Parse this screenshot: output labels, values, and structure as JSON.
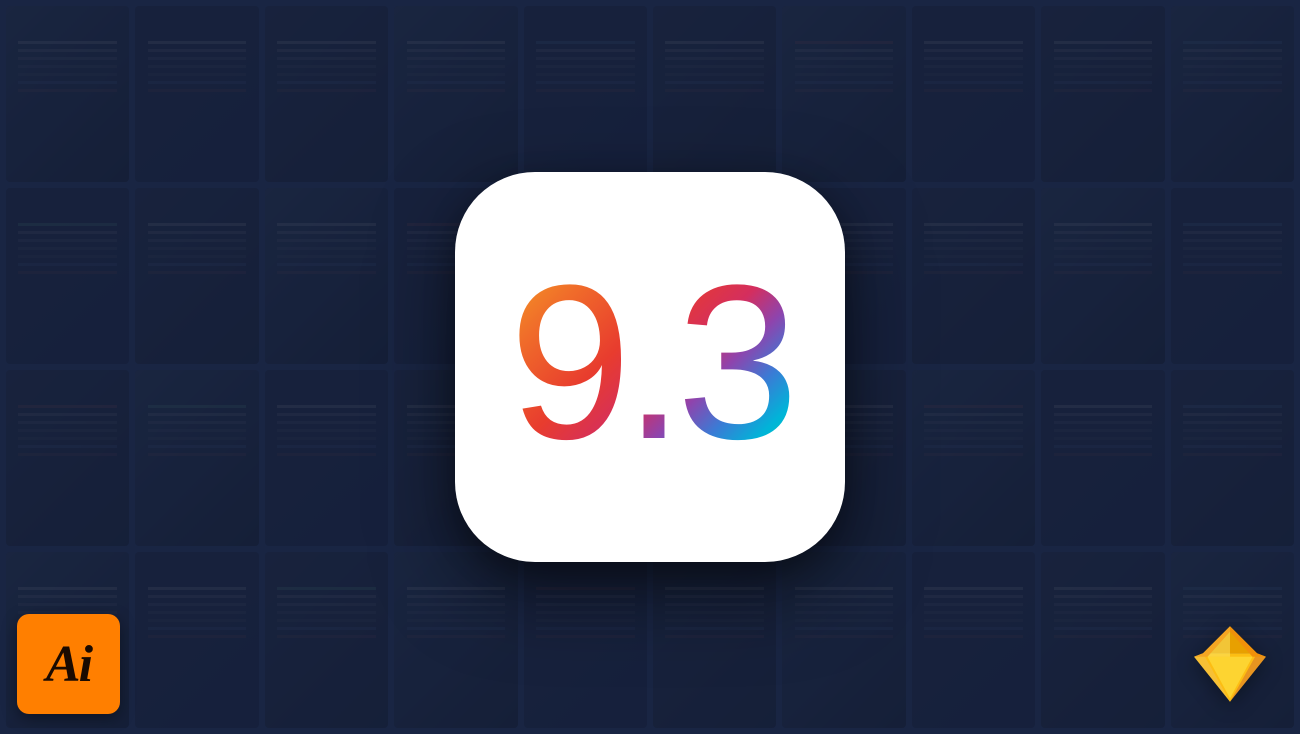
{
  "background": {
    "tile_count": 40,
    "overlay_color": "rgba(20,30,60,0.45)"
  },
  "center_icon": {
    "version": "9.3",
    "border_radius": "80px",
    "gradient_start": "#f5a623",
    "gradient_end": "#06d6a0"
  },
  "ai_badge": {
    "label": "Ai",
    "bg_color": "#FF7F00",
    "text_color": "#1a0a00"
  },
  "sketch_badge": {
    "label": "Sketch",
    "type": "logo"
  }
}
